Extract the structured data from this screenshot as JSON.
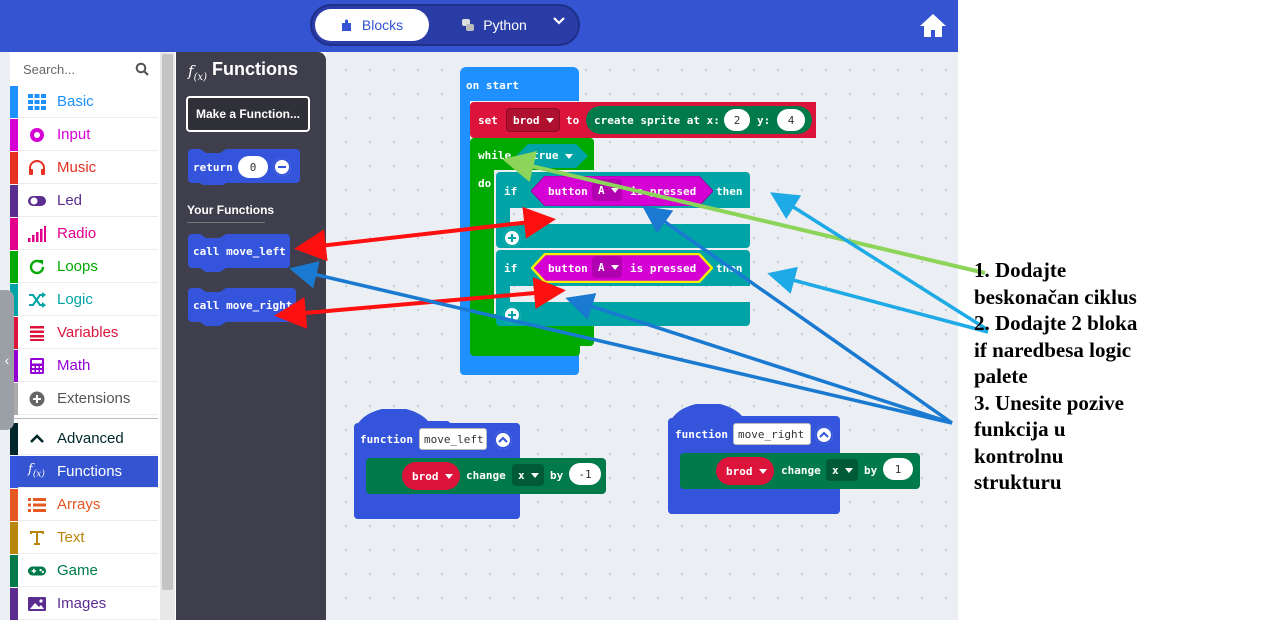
{
  "topbar": {
    "blocks_label": "Blocks",
    "python_label": "Python",
    "colors": {
      "bar": "#3454d1"
    }
  },
  "toolbox": {
    "search_placeholder": "Search...",
    "categories": [
      {
        "label": "Basic",
        "color": "#1e90ff",
        "icon": "grid-icon"
      },
      {
        "label": "Input",
        "color": "#d400d4",
        "icon": "circle-target-icon"
      },
      {
        "label": "Music",
        "color": "#e63022",
        "icon": "headphones-icon"
      },
      {
        "label": "Led",
        "color": "#5c2d91",
        "icon": "toggle-icon"
      },
      {
        "label": "Radio",
        "color": "#e3008c",
        "icon": "signal-bars-icon"
      },
      {
        "label": "Loops",
        "color": "#00aa00",
        "icon": "refresh-icon"
      },
      {
        "label": "Logic",
        "color": "#00a4a6",
        "icon": "shuffle-icon"
      },
      {
        "label": "Variables",
        "color": "#dc143c",
        "icon": "list-lines-icon"
      },
      {
        "label": "Math",
        "color": "#9400d3",
        "icon": "calculator-icon"
      },
      {
        "label": "Extensions",
        "color": "#555555",
        "icon": "plus-circle-icon"
      }
    ],
    "advanced_categories": [
      {
        "label": "Advanced",
        "color": "#00272b",
        "icon": "chevron-up-icon"
      },
      {
        "label": "Functions",
        "color": "#3455db",
        "icon": "fx-icon",
        "active": true
      },
      {
        "label": "Arrays",
        "color": "#e65722",
        "icon": "list-icon"
      },
      {
        "label": "Text",
        "color": "#b8860b",
        "icon": "text-icon"
      },
      {
        "label": "Game",
        "color": "#007a4b",
        "icon": "gamepad-icon"
      },
      {
        "label": "Images",
        "color": "#5c2d91",
        "icon": "image-icon"
      }
    ]
  },
  "flyout": {
    "title": "Functions",
    "make_function": "Make a Function...",
    "return_label": "return",
    "return_value": "0",
    "your_functions": "Your Functions",
    "call_left": "call move_left",
    "call_right": "call move_right"
  },
  "workspace": {
    "on_start": "on start",
    "set": "set",
    "var": "brod",
    "to": "to",
    "create_sprite": "create sprite at x:",
    "x_val": "2",
    "y_label": "y:",
    "y_val": "4",
    "while": "while",
    "true": "true",
    "do": "do",
    "if1": "if",
    "button1": "button",
    "btn1_val": "A",
    "pressed1": "is pressed",
    "then1": "then",
    "if2": "if",
    "button2": "button",
    "btn2_val": "A",
    "pressed2": "is pressed",
    "then2": "then",
    "fn_left_kw": "function",
    "fn_left_name": "move_left",
    "fn_left_var": "brod",
    "fn_left_change": "change",
    "fn_left_axis": "x",
    "fn_left_by": "by",
    "fn_left_val": "-1",
    "fn_right_kw": "function",
    "fn_right_name": "move_right",
    "fn_right_var": "brod",
    "fn_right_change": "change",
    "fn_right_axis": "x",
    "fn_right_by": "by",
    "fn_right_val": "1"
  },
  "instructions": [
    "1. Dodajte",
    "beskonačan ciklus",
    "2. Dodajte 2 bloka",
    "if naredbesa logic",
    "palete",
    "3. Unesite pozive",
    "funkcija u",
    "kontrolnu",
    "strukturu"
  ]
}
